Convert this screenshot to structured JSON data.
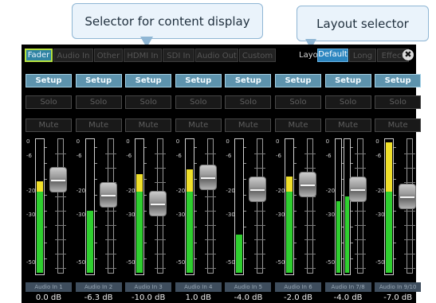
{
  "callouts": {
    "content": "Selector for content display",
    "layout": "Layout selector"
  },
  "tabs": [
    {
      "label": "Fader",
      "active": true
    },
    {
      "label": "Audio In",
      "active": false
    },
    {
      "label": "Other",
      "active": false
    },
    {
      "label": "HDMI In",
      "active": false
    },
    {
      "label": "SDI In",
      "active": false
    },
    {
      "label": "Audio Out",
      "active": false
    },
    {
      "label": "Custom",
      "active": false
    }
  ],
  "layout": {
    "label": "Layout",
    "options": [
      {
        "label": "Default",
        "active": true
      },
      {
        "label": "Long",
        "active": false
      },
      {
        "label": "Effect",
        "active": false
      }
    ]
  },
  "close_glyph": "✖",
  "buttons": {
    "setup": "Setup",
    "solo": "Solo",
    "mute": "Mute"
  },
  "scale_labels": [
    "0",
    "-6",
    "-20",
    "-30",
    "-50"
  ],
  "colors": {
    "meter_green": "#2fd02f",
    "meter_yellow": "#f0e02a",
    "accent": "#2f83a3",
    "active_border": "#b6e13f"
  },
  "channels": [
    {
      "name": "Audio In 1",
      "db": "0.0 dB",
      "levels": [
        {
          "level_db": -16
        }
      ]
    },
    {
      "name": "Audio In 2",
      "db": "-6.3 dB",
      "levels": [
        {
          "level_db": -28
        }
      ]
    },
    {
      "name": "Audio In 3",
      "db": "-10.0 dB",
      "levels": [
        {
          "level_db": -13
        }
      ]
    },
    {
      "name": "Audio In 4",
      "db": "1.0 dB",
      "levels": [
        {
          "level_db": -11
        }
      ]
    },
    {
      "name": "Audio In 5",
      "db": "-4.0 dB",
      "levels": [
        {
          "level_db": -38
        }
      ]
    },
    {
      "name": "Audio In 6",
      "db": "-2.0 dB",
      "levels": [
        {
          "level_db": -14
        }
      ]
    },
    {
      "name": "Audio In 7/8",
      "db": "-4.0 dB",
      "levels": [
        {
          "level_db": -24
        },
        {
          "level_db": -22
        }
      ]
    },
    {
      "name": "Audio In 9/10",
      "db": "-7.0 dB",
      "levels": [
        {
          "level_db": 0
        }
      ]
    }
  ]
}
